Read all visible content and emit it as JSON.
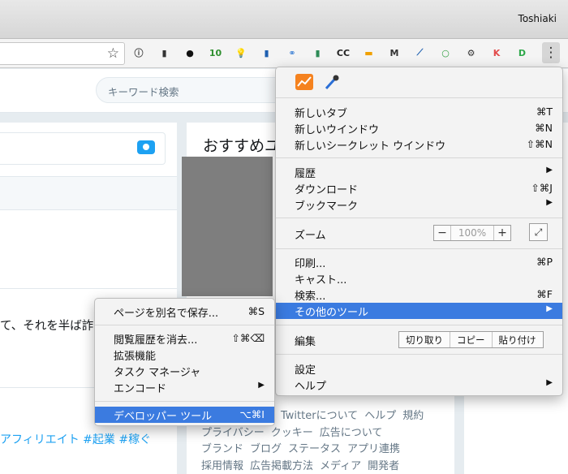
{
  "window": {
    "profile_name": "Toshiaki"
  },
  "toolbar": {
    "bookmark_icon": "star-outline-icon",
    "extensions": [
      {
        "name": "info-circle-icon",
        "glyph": "ⓘ",
        "color": "#444444"
      },
      {
        "name": "dark-square-icon",
        "glyph": "▮",
        "color": "#333333"
      },
      {
        "name": "ghost-icon",
        "glyph": "●",
        "color": "#111111"
      },
      {
        "name": "calendar-10-icon",
        "glyph": "10",
        "color": "#2f8f2f"
      },
      {
        "name": "lightbulb-icon",
        "glyph": "💡",
        "color": "#e6b800"
      },
      {
        "name": "bookmark-ribbon-icon",
        "glyph": "▮",
        "color": "#1e5fb0"
      },
      {
        "name": "link-chain-icon",
        "glyph": "⚭",
        "color": "#3a7fd5"
      },
      {
        "name": "bar-chart-icon",
        "glyph": "▮",
        "color": "#2e8b57"
      },
      {
        "name": "cc-icon",
        "glyph": "CC",
        "color": "#222222"
      },
      {
        "name": "orange-box-icon",
        "glyph": "▬",
        "color": "#f0a000"
      },
      {
        "name": "m-logo-icon",
        "glyph": "M",
        "color": "#333333"
      },
      {
        "name": "dart-icon",
        "glyph": "⟋",
        "color": "#1d5fb0"
      },
      {
        "name": "green-circle-icon",
        "glyph": "○",
        "color": "#2e9e3e"
      },
      {
        "name": "gear-icon",
        "glyph": "⚙",
        "color": "#333333"
      },
      {
        "name": "red-k-icon",
        "glyph": "K",
        "color": "#e24a4a"
      },
      {
        "name": "green-d-icon",
        "glyph": "D",
        "color": "#2ea84a"
      }
    ],
    "menu_icon": "kebab-menu-icon"
  },
  "page": {
    "search_placeholder": "キーワード検索",
    "recommend_title": "おすすめユ",
    "tweet_fragment": "て、それを半ば詐",
    "hashtags": "アフィリエイト #起業 #稼ぐ",
    "footer_links": [
      "Twitterについて",
      "ヘルプ",
      "規約",
      "プライバシー",
      "クッキー",
      "広告について",
      "ブランド",
      "ブログ",
      "ステータス",
      "アプリ連携",
      "採用情報",
      "広告掲載方法",
      "メディア",
      "開発者"
    ]
  },
  "main_menu": {
    "icons": [
      "analytics-chart-icon",
      "eyedropper-icon"
    ],
    "items": [
      {
        "label": "新しいタブ",
        "shortcut": "⌘T"
      },
      {
        "label": "新しいウインドウ",
        "shortcut": "⌘N"
      },
      {
        "label": "新しいシークレット ウインドウ",
        "shortcut": "⇧⌘N"
      },
      {
        "label": "履歴",
        "arrow": "▶"
      },
      {
        "label": "ダウンロード",
        "shortcut": "⇧⌘J"
      },
      {
        "label": "ブックマーク",
        "arrow": "▶"
      },
      {
        "label": "ズーム"
      },
      {
        "label": "印刷...",
        "shortcut": "⌘P"
      },
      {
        "label": "キャスト..."
      },
      {
        "label": "検索...",
        "shortcut": "⌘F"
      },
      {
        "label": "その他のツール",
        "arrow": "▶"
      },
      {
        "label": "編集"
      },
      {
        "label": "設定"
      },
      {
        "label": "ヘルプ",
        "arrow": "▶"
      }
    ],
    "zoom": {
      "minus": "−",
      "value": "100%",
      "plus": "+",
      "fullscreen": "⤢"
    },
    "edit_buttons": {
      "cut": "切り取り",
      "copy": "コピー",
      "paste": "貼り付け"
    }
  },
  "sub_menu": {
    "items": [
      {
        "label": "ページを別名で保存...",
        "shortcut": "⌘S"
      },
      {
        "label": "閲覧履歴を消去...",
        "shortcut": "⇧⌘⌫"
      },
      {
        "label": "拡張機能"
      },
      {
        "label": "タスク マネージャ"
      },
      {
        "label": "エンコード",
        "arrow": "▶"
      },
      {
        "label": "デベロッパー ツール",
        "shortcut": "⌥⌘I"
      }
    ]
  },
  "colors": {
    "highlight": "#3b7be0",
    "twitter_blue": "#1da1f2"
  }
}
